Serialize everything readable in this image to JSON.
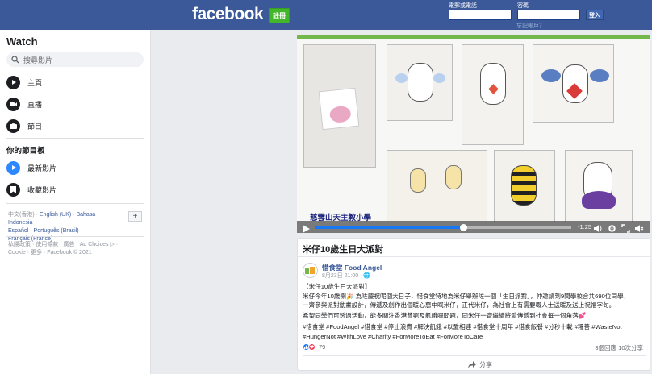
{
  "header": {
    "logo": "facebook",
    "signup_label": "註冊",
    "email_label": "電郵或電話",
    "password_label": "密碼",
    "login_label": "登入",
    "forgot_label": "忘記帳戶？"
  },
  "sidebar": {
    "title": "Watch",
    "search_placeholder": "搜尋影片",
    "nav": [
      {
        "label": "主頁",
        "icon": "play-icon"
      },
      {
        "label": "直播",
        "icon": "live-camera-icon"
      },
      {
        "label": "節目",
        "icon": "shows-icon"
      }
    ],
    "section_title": "你的節目板",
    "saved": [
      {
        "label": "最新影片",
        "icon": "play-circle-icon"
      },
      {
        "label": "收藏影片",
        "icon": "bookmark-icon"
      }
    ],
    "languages": {
      "current": "中文(香港)",
      "others": [
        "English (UK)",
        "Bahasa Indonesia",
        "Español",
        "Português (Brasil)",
        "Français (France)"
      ]
    },
    "footer": {
      "links": [
        "私隱政策",
        "使用條款",
        "廣告",
        "Ad Choices",
        "Cookie",
        "更多"
      ],
      "copyright": "Facebook © 2021"
    }
  },
  "video": {
    "caption": "慈雲山天主教小學",
    "time": "-1:25",
    "progress": 0.58,
    "accent": "#73b84a"
  },
  "post": {
    "title": "米仔10歲生日大派對",
    "page_name": "惜食堂 Food Angel",
    "meta": "8月23日 21:00 · ",
    "line1": "【米仔10歲生日大派對】",
    "line2": "米仔今年10歲喇🎉 為咗慶祝呢個大日子，惜食堂特地為米仔舉辦咗一個「生日派對」，仲邀請到9間學校合共690位同學，",
    "line3": "一齊參與派對動畫設計，傳遞及創作出個暖心惡中嘅米仔，正代米仔，為社會上有需要嘅人士送暖及送上祝福字句。",
    "line4": "希望同學們可透過活動，能多關注香港貧窮及飢餓嘅問題，同米仔一齊繼續將愛傳遞到社會每一個角落💕",
    "hashtags": "#惜食堂 #FoodAngel #惜食堂 #停止浪費 #解決飢餓 #以愛相連 #惜食堂十周年 #惜食飯餐 #分秒十載 #糧善 #WasteNot #HungerNot #WithLove #Charity #ForMoreToEat #ForMoreToCare",
    "reaction_count": "79",
    "stats": "3個回應  10次分享",
    "share_label": "分享"
  }
}
